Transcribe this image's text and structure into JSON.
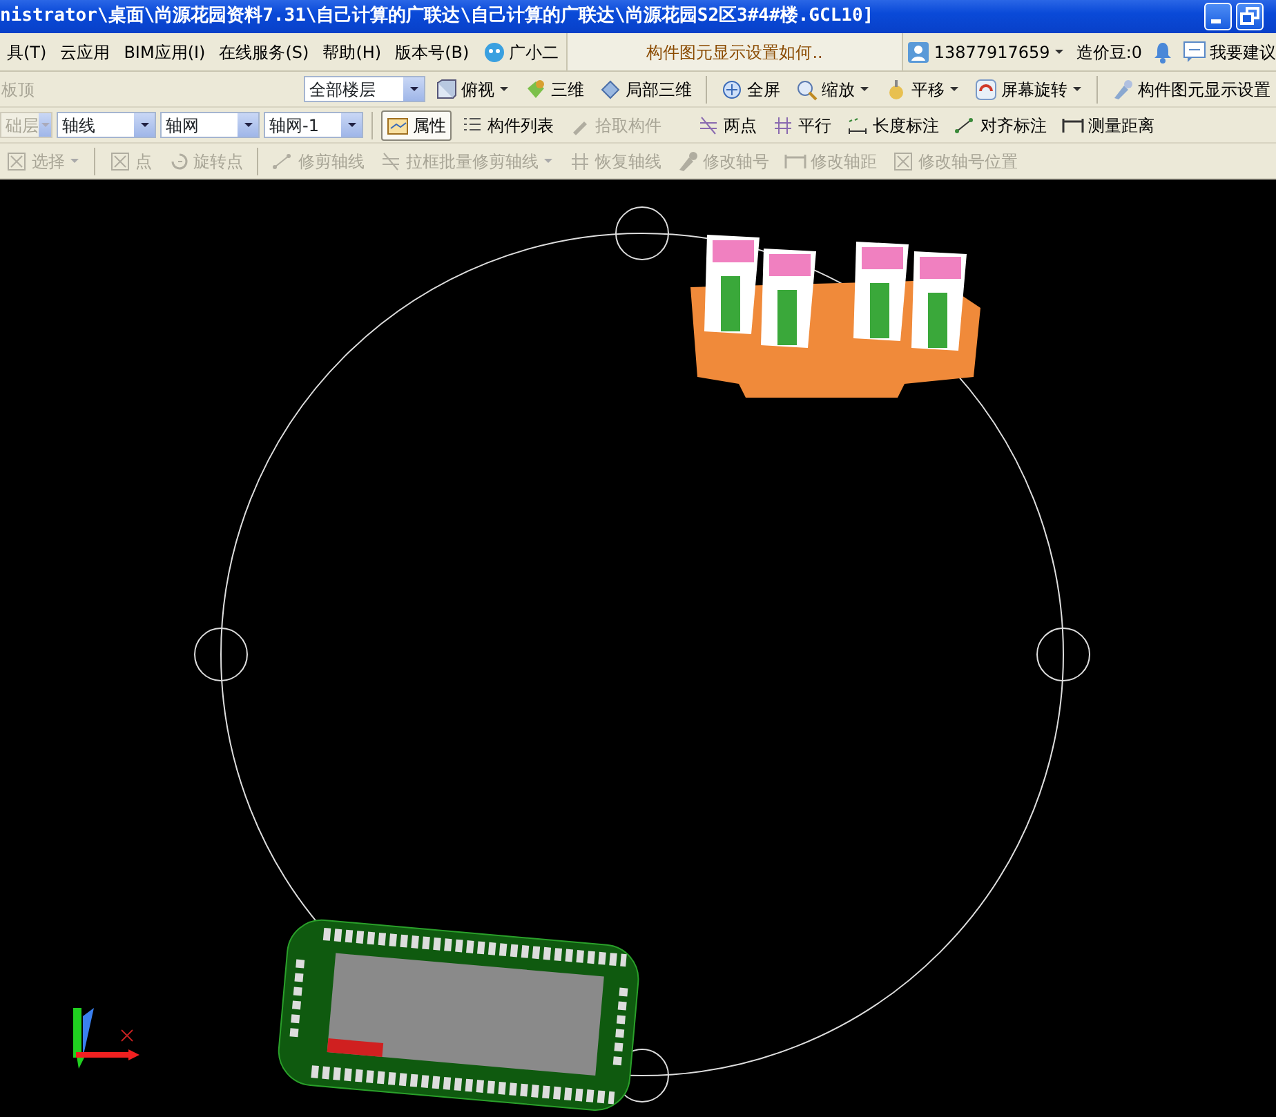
{
  "window": {
    "title": "nistrator\\桌面\\尚源花园资料7.31\\自己计算的广联达\\自己计算的广联达\\尚源花园S2区3#4#楼.GCL10]"
  },
  "menu": [
    {
      "label": "具(T)"
    },
    {
      "label": "云应用"
    },
    {
      "label": "BIM应用(I)"
    },
    {
      "label": "在线服务(S)"
    },
    {
      "label": "帮助(H)"
    },
    {
      "label": "版本号(B)"
    },
    {
      "label": "广小二",
      "kind": "assistant"
    }
  ],
  "tip": "构件图元显示设置如何..",
  "account": {
    "phone": "13877917659",
    "beans": "造价豆:0",
    "suggest": "我要建议"
  },
  "toolbar_rows": [
    [
      {
        "kind": "label",
        "label": "板顶",
        "disabled": true
      },
      {
        "kind": "select",
        "value": "全部楼层",
        "disabled": false
      },
      {
        "kind": "button",
        "label": "俯视",
        "dropdown": true,
        "disabled": false,
        "pressed": false
      },
      {
        "kind": "button",
        "label": "三维",
        "dropdown": false,
        "disabled": false,
        "pressed": false
      },
      {
        "kind": "button",
        "label": "局部三维",
        "dropdown": false,
        "disabled": false,
        "pressed": false
      },
      {
        "kind": "separator"
      },
      {
        "kind": "button",
        "label": "全屏",
        "dropdown": false,
        "disabled": false,
        "pressed": false
      },
      {
        "kind": "button",
        "label": "缩放",
        "dropdown": true,
        "disabled": false,
        "pressed": false
      },
      {
        "kind": "button",
        "label": "平移",
        "dropdown": true,
        "disabled": false,
        "pressed": false
      },
      {
        "kind": "button",
        "label": "屏幕旋转",
        "dropdown": true,
        "disabled": false,
        "pressed": false
      },
      {
        "kind": "separator"
      },
      {
        "kind": "button",
        "label": "构件图元显示设置",
        "dropdown": false,
        "disabled": false,
        "pressed": false
      }
    ],
    [
      {
        "kind": "select",
        "value": "础层",
        "disabled": true
      },
      {
        "kind": "select",
        "value": "轴线",
        "disabled": false
      },
      {
        "kind": "select",
        "value": "轴网",
        "disabled": false
      },
      {
        "kind": "select",
        "value": "轴网-1",
        "disabled": false
      },
      {
        "kind": "separator"
      },
      {
        "kind": "button",
        "label": "属性",
        "dropdown": false,
        "disabled": false,
        "pressed": true
      },
      {
        "kind": "button",
        "label": "构件列表",
        "dropdown": false,
        "disabled": false,
        "pressed": false
      },
      {
        "kind": "button",
        "label": "拾取构件",
        "dropdown": false,
        "disabled": true,
        "pressed": false
      },
      {
        "kind": "gap"
      },
      {
        "kind": "button",
        "label": "两点",
        "dropdown": false,
        "disabled": false,
        "pressed": false
      },
      {
        "kind": "button",
        "label": "平行",
        "dropdown": false,
        "disabled": false,
        "pressed": false
      },
      {
        "kind": "button",
        "label": "长度标注",
        "dropdown": false,
        "disabled": false,
        "pressed": false
      },
      {
        "kind": "button",
        "label": "对齐标注",
        "dropdown": false,
        "disabled": false,
        "pressed": false
      },
      {
        "kind": "button",
        "label": "测量距离",
        "dropdown": false,
        "disabled": false,
        "pressed": false
      }
    ],
    [
      {
        "kind": "button",
        "label": "选择",
        "dropdown": true,
        "disabled": true,
        "pressed": false
      },
      {
        "kind": "separator"
      },
      {
        "kind": "button",
        "label": "点",
        "dropdown": false,
        "disabled": true,
        "pressed": false
      },
      {
        "kind": "button",
        "label": "旋转点",
        "dropdown": false,
        "disabled": true,
        "pressed": false
      },
      {
        "kind": "separator"
      },
      {
        "kind": "button",
        "label": "修剪轴线",
        "dropdown": false,
        "disabled": true,
        "pressed": false
      },
      {
        "kind": "button",
        "label": "拉框批量修剪轴线",
        "dropdown": true,
        "disabled": true,
        "pressed": false
      },
      {
        "kind": "button",
        "label": "恢复轴线",
        "dropdown": false,
        "disabled": true,
        "pressed": false
      },
      {
        "kind": "button",
        "label": "修改轴号",
        "dropdown": false,
        "disabled": true,
        "pressed": false
      },
      {
        "kind": "button",
        "label": "修改轴距",
        "dropdown": false,
        "disabled": true,
        "pressed": false
      },
      {
        "kind": "button",
        "label": "修改轴号位置",
        "dropdown": false,
        "disabled": true,
        "pressed": false
      }
    ]
  ]
}
